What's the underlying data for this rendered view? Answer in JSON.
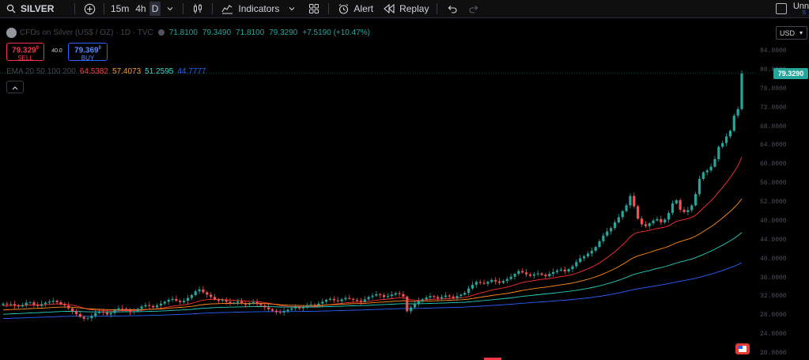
{
  "toolbar": {
    "symbol": "SILVER",
    "intervals": [
      "15m",
      "4h",
      "D"
    ],
    "active_interval": 2,
    "indicators_label": "Indicators",
    "alert_label": "Alert",
    "replay_label": "Replay",
    "user_label": "Unn",
    "user_sub": "S"
  },
  "legend": {
    "title": "CFDs on Silver (US$ / OZ) · 1D · TVC",
    "open": "71.8100",
    "high": "79.3490",
    "low": "71.8100",
    "close": "79.3290",
    "change": "+7.5190 (+10.47%)",
    "currency": "USD"
  },
  "trade": {
    "sell_price": "79.329",
    "sell_sup": "0",
    "sell_label": "SELL",
    "spread": "40.0",
    "buy_price": "79.369",
    "buy_sup": "0",
    "buy_label": "BUY"
  },
  "ema": {
    "label": "EMA 20 50 100 200",
    "v20": "64.5382",
    "v50": "57.4073",
    "v100": "51.2595",
    "v200": "44.7777"
  },
  "colors": {
    "up": "#26a69a",
    "down": "#ef5350",
    "ema20": "#ff3030",
    "ema50": "#ff8c1a",
    "ema100": "#26d0c0",
    "ema200": "#2962ff"
  },
  "icons": [
    "search-icon",
    "plus-circle-icon",
    "candles-icon",
    "indicators-icon",
    "templates-icon",
    "alert-icon",
    "replay-icon",
    "undo-icon",
    "redo-icon"
  ],
  "chart_data": {
    "type": "line",
    "series_candles": "price",
    "price_axis_ticks": [
      84,
      80,
      76,
      72,
      68,
      64,
      60,
      56,
      52,
      48,
      44,
      40,
      36,
      32,
      28,
      24,
      20
    ],
    "ylim": [
      20,
      86
    ],
    "last_price": "79.3290",
    "tick_labels": [
      "84.0000",
      "80.0000",
      "76.0000",
      "72.0000",
      "68.0000",
      "64.0000",
      "60.0000",
      "56.0000",
      "52.0000",
      "48.0000",
      "44.0000",
      "40.0000",
      "36.0000",
      "32.0000",
      "28.0000",
      "24.0000",
      "20.0000"
    ],
    "closes": [
      30.6,
      30.4,
      30.5,
      30.2,
      30.0,
      30.3,
      30.8,
      30.9,
      30.4,
      30.1,
      30.5,
      30.8,
      31.0,
      31.2,
      30.9,
      30.4,
      30.2,
      29.6,
      29.0,
      28.4,
      27.8,
      27.4,
      27.5,
      28.0,
      28.6,
      28.9,
      28.7,
      28.3,
      28.6,
      29.2,
      29.6,
      29.5,
      29.2,
      28.8,
      29.0,
      29.5,
      30.0,
      30.3,
      30.1,
      29.8,
      30.2,
      30.6,
      31.0,
      31.4,
      31.6,
      31.2,
      30.9,
      31.2,
      31.8,
      32.4,
      33.2,
      33.6,
      33.0,
      32.5,
      32.0,
      31.5,
      31.2,
      31.4,
      31.0,
      30.6,
      30.8,
      31.1,
      30.7,
      30.4,
      30.6,
      30.9,
      30.5,
      30.2,
      29.8,
      29.4,
      29.1,
      28.8,
      28.7,
      29.0,
      29.3,
      29.6,
      29.8,
      29.6,
      29.9,
      30.2,
      30.4,
      30.3,
      30.6,
      31.0,
      31.4,
      31.6,
      31.3,
      31.1,
      31.5,
      31.8,
      31.6,
      31.4,
      31.2,
      31.0,
      31.5,
      32.0,
      32.3,
      32.6,
      32.4,
      32.0,
      32.2,
      32.5,
      32.8,
      32.6,
      32.1,
      29.0,
      29.8,
      30.6,
      31.2,
      31.5,
      31.9,
      32.2,
      32.0,
      31.7,
      32.0,
      32.3,
      32.1,
      31.8,
      32.2,
      32.5,
      32.9,
      33.8,
      34.6,
      35.2,
      35.0,
      34.8,
      35.2,
      35.6,
      35.3,
      35.0,
      35.4,
      35.8,
      36.3,
      36.9,
      37.5,
      37.2,
      36.8,
      36.5,
      36.8,
      37.0,
      36.7,
      36.4,
      36.9,
      37.3,
      37.6,
      37.8,
      37.4,
      37.9,
      38.5,
      39.4,
      40.2,
      40.6,
      41.2,
      41.8,
      42.6,
      43.8,
      45.0,
      45.9,
      46.6,
      47.8,
      48.9,
      50.2,
      51.4,
      53.4,
      51.2,
      48.6,
      47.4,
      47.0,
      47.6,
      48.2,
      48.5,
      47.8,
      48.4,
      49.8,
      51.8,
      52.5,
      50.5,
      50.0,
      50.4,
      51.4,
      53.8,
      57.0,
      58.4,
      58.8,
      59.6,
      61.2,
      63.8,
      64.6,
      66.0,
      67.2,
      70.4,
      71.8,
      79.3
    ]
  }
}
